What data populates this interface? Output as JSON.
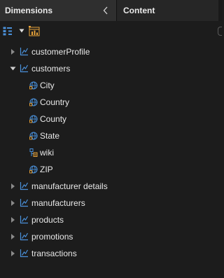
{
  "header": {
    "dimensions_tab": "Dimensions",
    "content_tab": "Content"
  },
  "colors": {
    "background": "#1c1c1c",
    "header_active": "#2f2f2f",
    "icon_blue": "#4a90d9",
    "icon_orange": "#e8a33a",
    "text": "#e8e8e8"
  },
  "tree": {
    "dimensions": [
      {
        "label": "customerProfile",
        "expanded": false
      },
      {
        "label": "customers",
        "expanded": true,
        "attributes": [
          {
            "label": "City",
            "icon": "globe-icon"
          },
          {
            "label": "Country",
            "icon": "globe-icon"
          },
          {
            "label": "County",
            "icon": "globe-icon"
          },
          {
            "label": "State",
            "icon": "globe-icon"
          },
          {
            "label": "wiki",
            "icon": "text-attribute-icon"
          },
          {
            "label": "ZIP",
            "icon": "globe-icon"
          }
        ]
      },
      {
        "label": "manufacturer details",
        "expanded": false
      },
      {
        "label": "manufacturers",
        "expanded": false
      },
      {
        "label": "products",
        "expanded": false
      },
      {
        "label": "promotions",
        "expanded": false
      },
      {
        "label": "transactions",
        "expanded": false
      }
    ]
  }
}
